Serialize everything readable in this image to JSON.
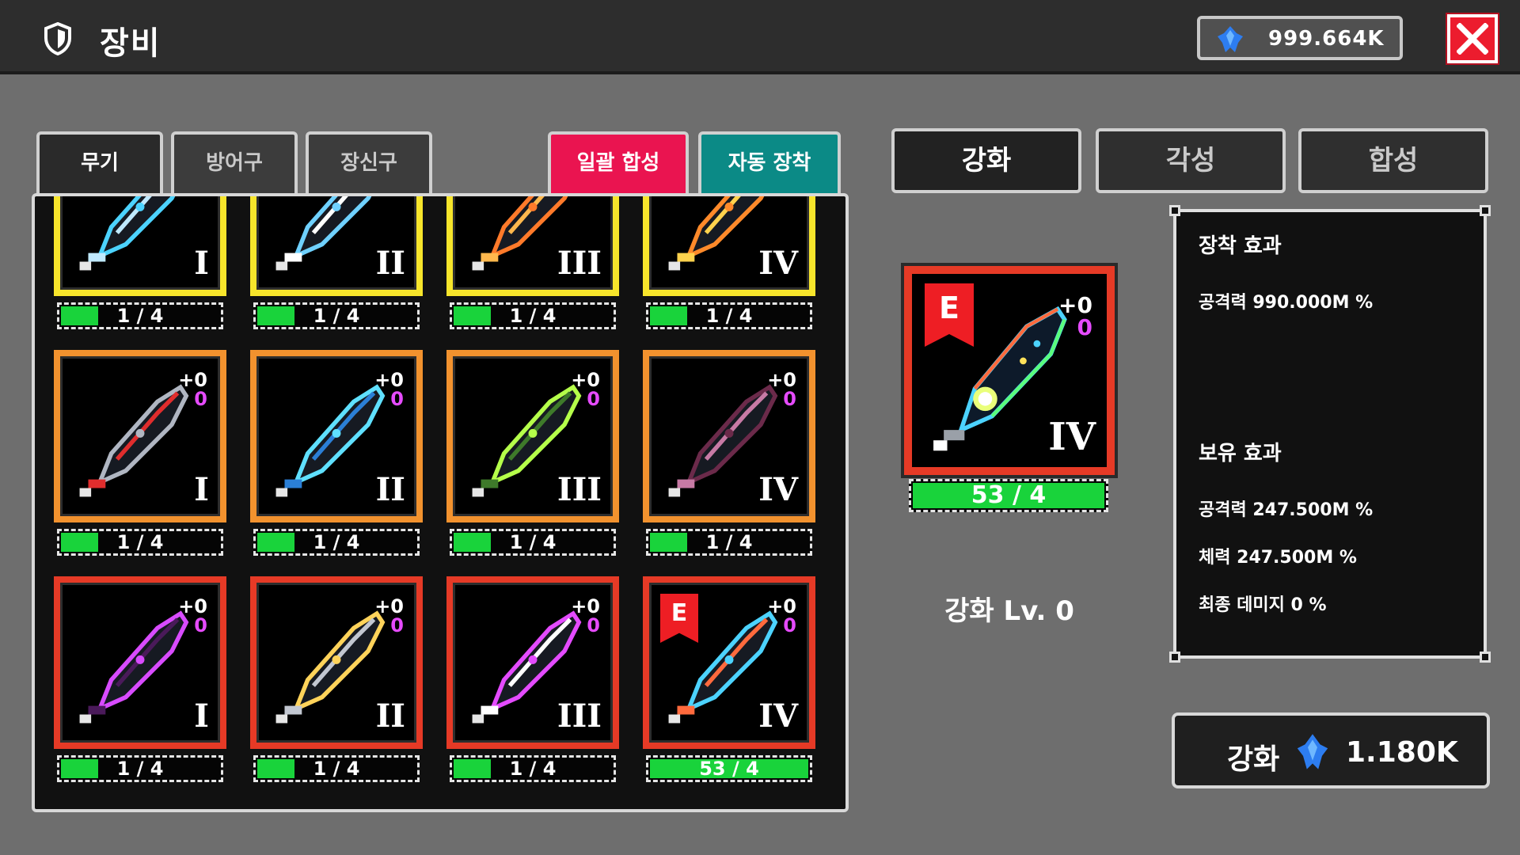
{
  "header": {
    "title": "장비",
    "currency": "999.664K"
  },
  "tabs": {
    "weapon": "무기",
    "armor": "방어구",
    "accessory": "장신구",
    "bulk_merge": "일괄 합성",
    "auto_equip": "자동 장착"
  },
  "right_tabs": {
    "enhance": "강화",
    "awaken": "각성",
    "merge": "합성"
  },
  "items": [
    {
      "tier": "I",
      "count": "1 / 4",
      "fill": 0.25,
      "rarity": "yellow"
    },
    {
      "tier": "II",
      "count": "1 / 4",
      "fill": 0.25,
      "rarity": "yellow"
    },
    {
      "tier": "III",
      "count": "1 / 4",
      "fill": 0.25,
      "rarity": "yellow"
    },
    {
      "tier": "IV",
      "count": "1 / 4",
      "fill": 0.25,
      "rarity": "yellow"
    },
    {
      "tier": "I",
      "count": "1 / 4",
      "fill": 0.25,
      "rarity": "orange",
      "plus": "+0",
      "plus2": "0"
    },
    {
      "tier": "II",
      "count": "1 / 4",
      "fill": 0.25,
      "rarity": "orange",
      "plus": "+0",
      "plus2": "0"
    },
    {
      "tier": "III",
      "count": "1 / 4",
      "fill": 0.25,
      "rarity": "orange",
      "plus": "+0",
      "plus2": "0"
    },
    {
      "tier": "IV",
      "count": "1 / 4",
      "fill": 0.25,
      "rarity": "orange",
      "plus": "+0",
      "plus2": "0"
    },
    {
      "tier": "I",
      "count": "1 / 4",
      "fill": 0.25,
      "rarity": "red",
      "plus": "+0",
      "plus2": "0"
    },
    {
      "tier": "II",
      "count": "1 / 4",
      "fill": 0.25,
      "rarity": "red",
      "plus": "+0",
      "plus2": "0"
    },
    {
      "tier": "III",
      "count": "1 / 4",
      "fill": 0.25,
      "rarity": "red",
      "plus": "+0",
      "plus2": "0"
    },
    {
      "tier": "IV",
      "count": "53 / 4",
      "fill": 1.0,
      "rarity": "red",
      "plus": "+0",
      "plus2": "0",
      "equipped": "E"
    }
  ],
  "detail": {
    "tier": "IV",
    "count": "53 / 4",
    "plus": "+0",
    "plus2": "0",
    "equipped": "E",
    "level": "강화 Lv. 0"
  },
  "effects": {
    "equip_title": "장착 효과",
    "equip_attack": "공격력 990.000M %",
    "own_title": "보유 효과",
    "own_attack": "공격력 247.500M %",
    "own_hp": "체력 247.500M %",
    "own_final": "최종 데미지 0 %"
  },
  "upgrade": {
    "label": "강화",
    "cost": "1.180K"
  },
  "colors": {
    "yellow": "#f7e52b",
    "orange": "#f2922e",
    "red": "#e63a26",
    "progress": "#19d33b",
    "bulk_merge": "#ea1450",
    "auto_equip": "#0b8a86"
  },
  "icons": {
    "title": "shield-icon",
    "currency": "blue-crystal-icon",
    "close": "close-icon"
  }
}
